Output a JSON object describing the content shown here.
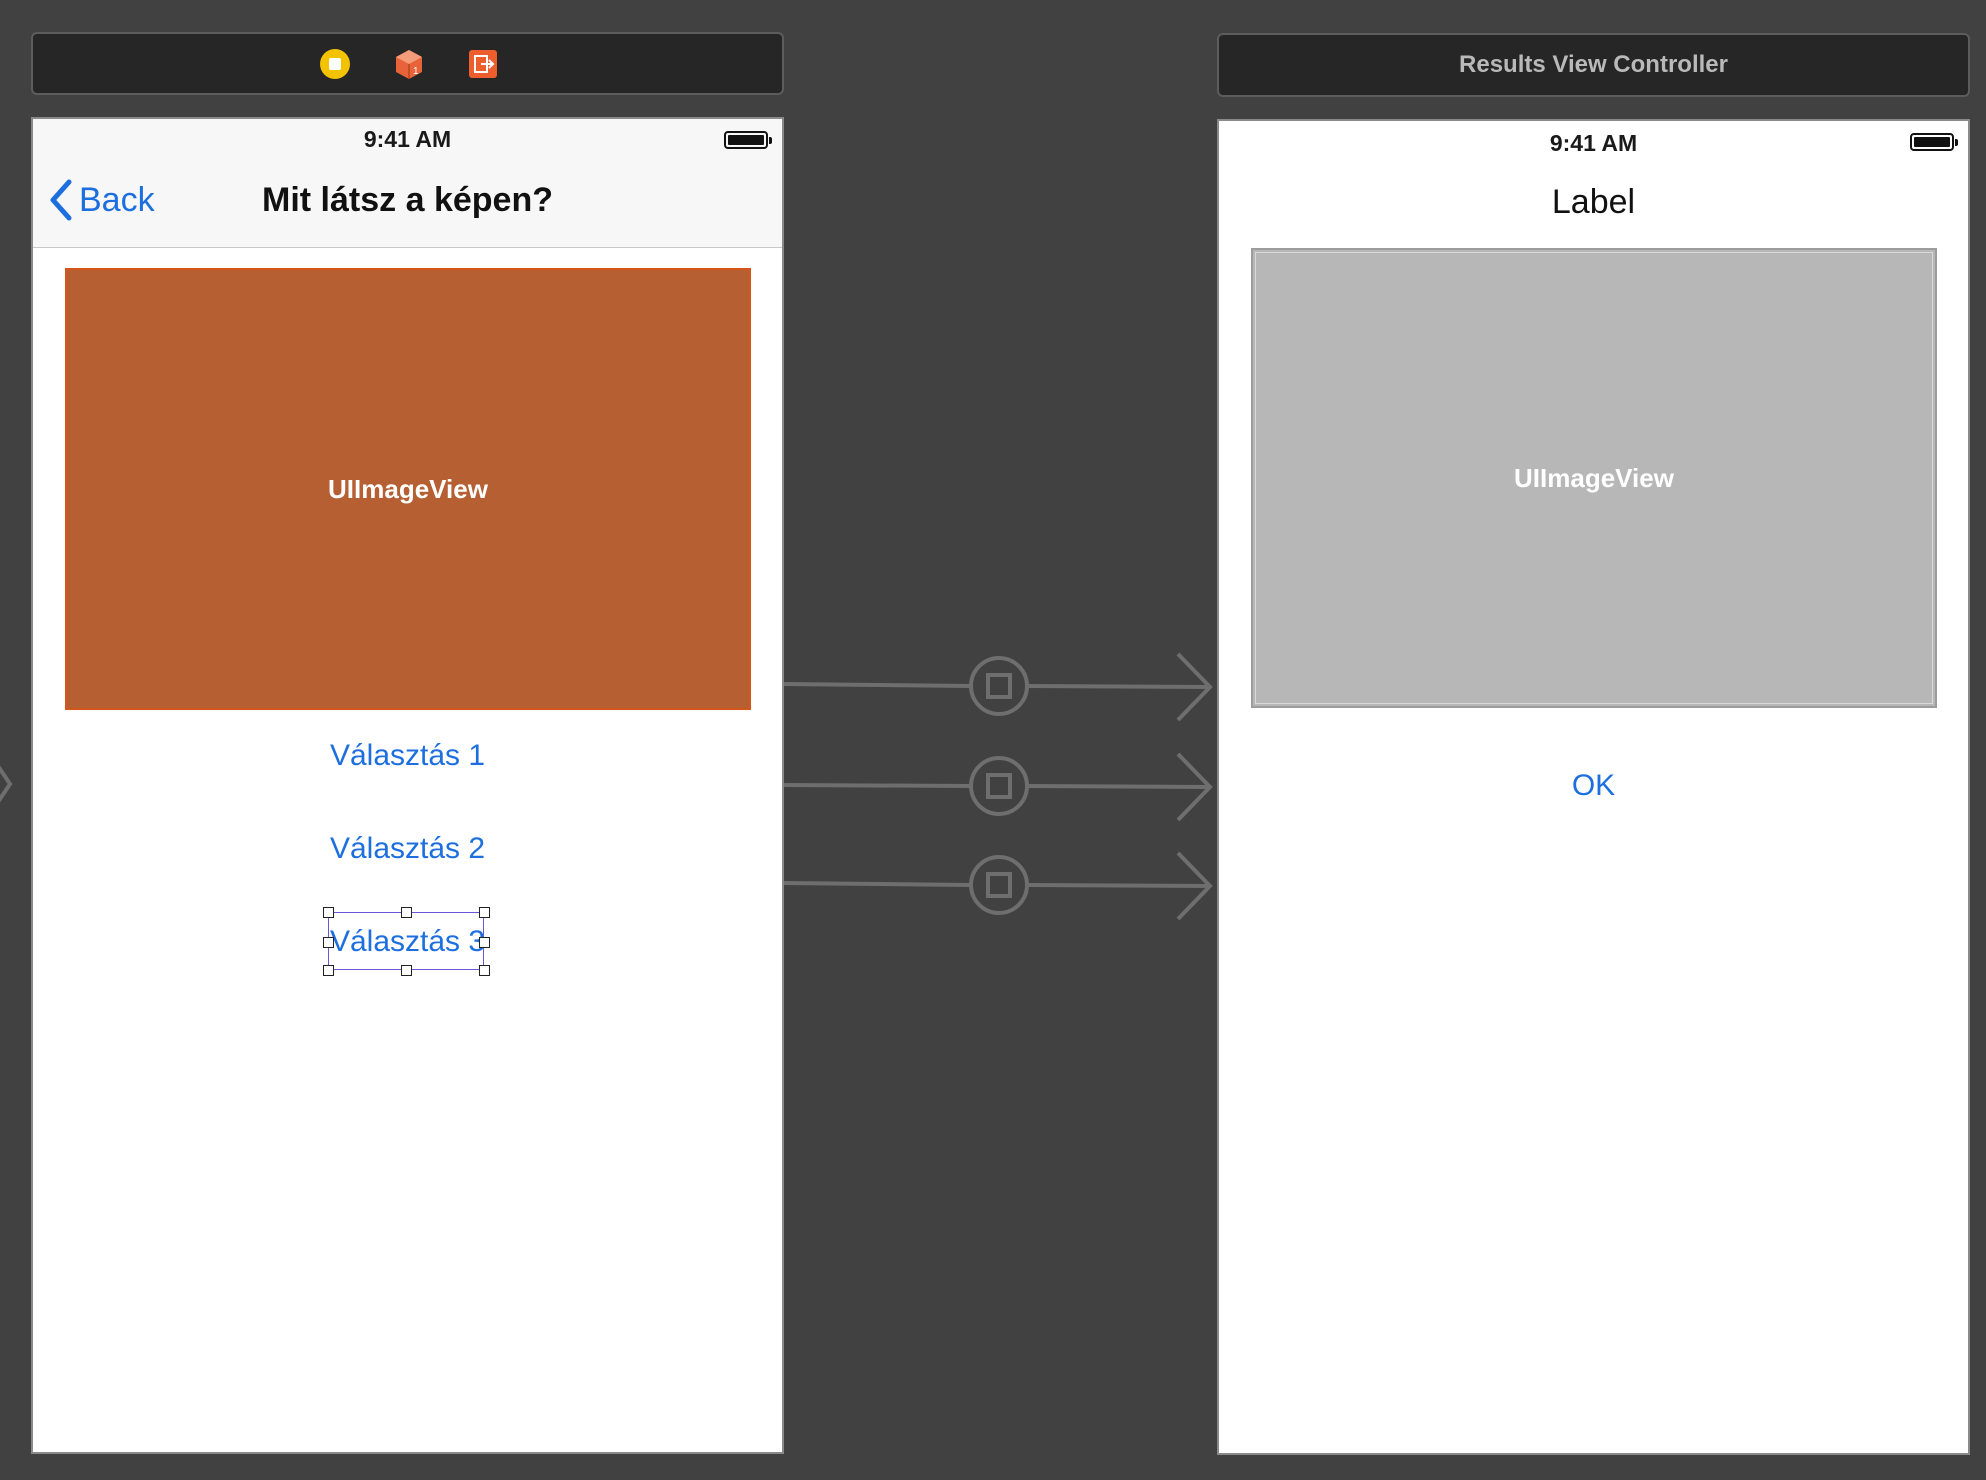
{
  "left_scene": {
    "status_time": "9:41 AM",
    "nav": {
      "back_label": "Back",
      "title": "Mit látsz a képen?"
    },
    "image_view_label": "UIImageView",
    "buttons": [
      "Választás 1",
      "Választás 2",
      "Választás 3"
    ],
    "titlebar_icons": [
      "view-controller-icon",
      "first-responder-icon",
      "exit-icon"
    ]
  },
  "right_scene": {
    "title": "Results View Controller",
    "status_time": "9:41 AM",
    "label": "Label",
    "image_view_label": "UIImageView",
    "ok_button": "OK"
  },
  "colors": {
    "canvas": "#414141",
    "accent_blue": "#1d6fe0",
    "image_view_orange": "#b55f33",
    "image_view_gray": "#b7b7b7",
    "selection": "#6b55d8"
  }
}
